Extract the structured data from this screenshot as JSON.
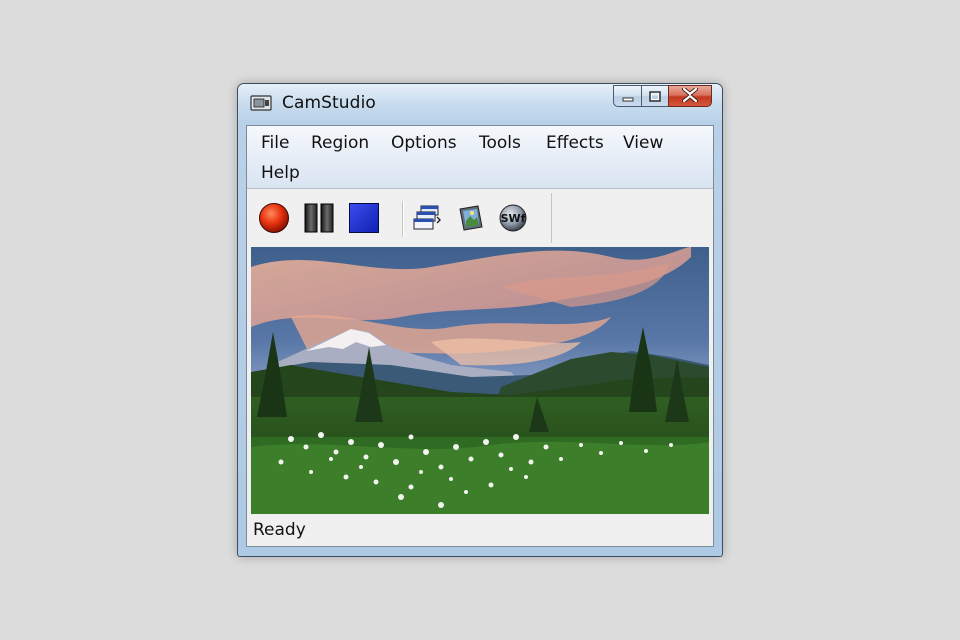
{
  "window": {
    "title": "CamStudio",
    "app_icon": "camcorder-icon",
    "caption_buttons": [
      {
        "name": "minimize-button",
        "icon": "minimize-icon"
      },
      {
        "name": "maximize-button",
        "icon": "maximize-icon"
      },
      {
        "name": "close-button",
        "icon": "close-icon",
        "color": "#c2381f"
      }
    ]
  },
  "menu": {
    "items": [
      "File",
      "Region",
      "Options",
      "Tools",
      "Effects",
      "View",
      "Help"
    ]
  },
  "toolbar": {
    "buttons": [
      {
        "name": "record-button",
        "icon": "record-icon",
        "color": "#e02a10"
      },
      {
        "name": "pause-button",
        "icon": "pause-icon",
        "color": "#333333"
      },
      {
        "name": "stop-button",
        "icon": "stop-icon",
        "color": "#1f2fc8"
      },
      {
        "name": "annotation-button",
        "icon": "windows-stack-icon"
      },
      {
        "name": "video-options-button",
        "icon": "video-frame-icon"
      },
      {
        "name": "swf-producer-button",
        "icon": "swf-icon",
        "label": "SWf"
      }
    ]
  },
  "preview": {
    "image": "mountain-meadow-photo"
  },
  "status": {
    "text": "Ready"
  }
}
